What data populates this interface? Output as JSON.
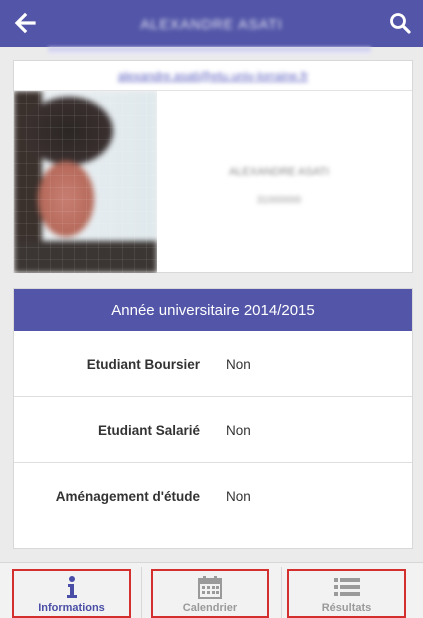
{
  "header": {
    "title": "ALEXANDRE ASATI",
    "back_icon": "arrow-left-icon",
    "search_icon": "search-icon"
  },
  "profile": {
    "link_text": "alexandre.asati@etu.univ-lorraine.fr",
    "name": "ALEXANDRE ASATI",
    "id": "31000000"
  },
  "year_card": {
    "title": "Année universitaire 2014/2015",
    "rows": [
      {
        "label": "Etudiant Boursier",
        "value": "Non"
      },
      {
        "label": "Etudiant Salarié",
        "value": "Non"
      },
      {
        "label": "Aménagement d'étude",
        "value": "Non"
      }
    ]
  },
  "nav": {
    "items": [
      {
        "label": "Informations",
        "icon": "info-icon",
        "active": true
      },
      {
        "label": "Calendrier",
        "icon": "calendar-icon",
        "active": false
      },
      {
        "label": "Résultats",
        "icon": "list-icon",
        "active": false
      }
    ]
  },
  "colors": {
    "primary": "#5356a8",
    "highlight_border": "#d32f2f",
    "background": "#ebebeb"
  }
}
